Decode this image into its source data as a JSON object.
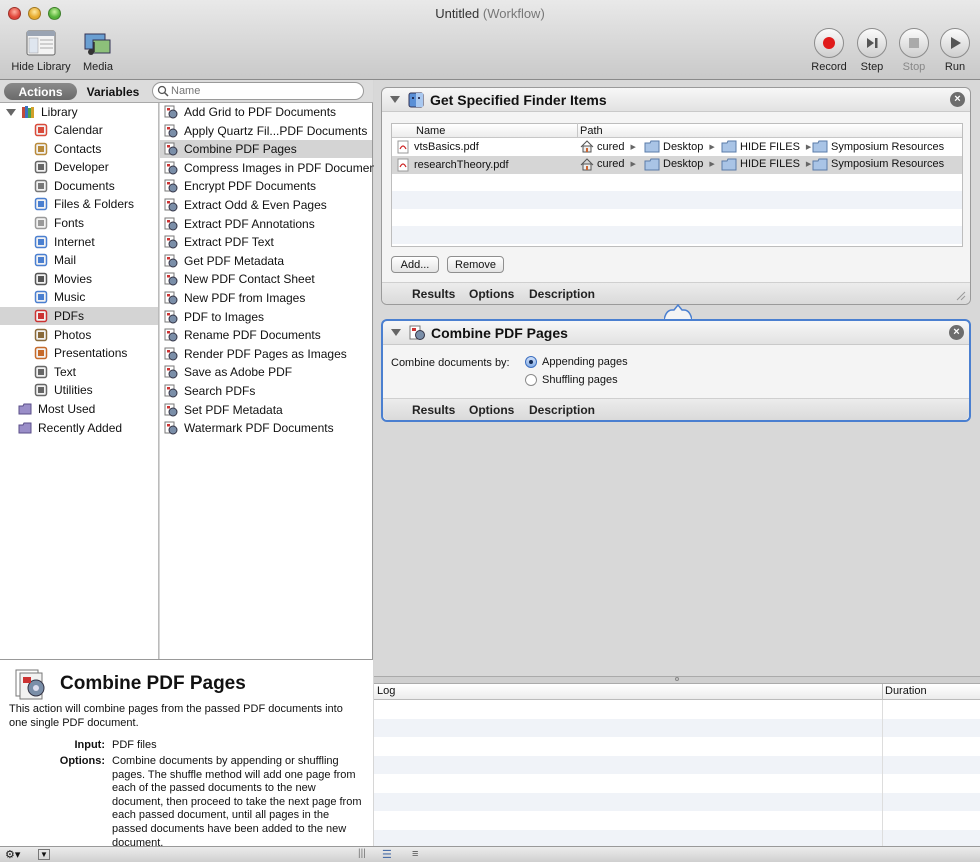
{
  "window": {
    "title": "Untitled",
    "subtitle": "(Workflow)"
  },
  "toolbar": {
    "hide_library": "Hide Library",
    "media": "Media",
    "record": "Record",
    "step": "Step",
    "stop": "Stop",
    "run": "Run"
  },
  "library": {
    "tab_actions": "Actions",
    "tab_variables": "Variables",
    "search_placeholder": "Name",
    "root": "Library",
    "categories": [
      "Calendar",
      "Contacts",
      "Developer",
      "Documents",
      "Files & Folders",
      "Fonts",
      "Internet",
      "Mail",
      "Movies",
      "Music",
      "PDFs",
      "Photos",
      "Presentations",
      "Text",
      "Utilities"
    ],
    "selected_category": "PDFs",
    "smart_groups": [
      "Most Used",
      "Recently Added"
    ],
    "actions": [
      "Add Grid to PDF Documents",
      "Apply Quartz Fil...PDF Documents",
      "Combine PDF Pages",
      "Compress Images in PDF Documents",
      "Encrypt PDF Documents",
      "Extract Odd & Even Pages",
      "Extract PDF Annotations",
      "Extract PDF Text",
      "Get PDF Metadata",
      "New PDF Contact Sheet",
      "New PDF from Images",
      "PDF to Images",
      "Rename PDF Documents",
      "Render PDF Pages as Images",
      "Save as Adobe PDF",
      "Search PDFs",
      "Set PDF Metadata",
      "Watermark PDF Documents"
    ],
    "selected_action": "Combine PDF Pages"
  },
  "description": {
    "title": "Combine PDF Pages",
    "summary": "This action will combine pages from the passed PDF documents into one single PDF document.",
    "input_label": "Input:",
    "input_value": "PDF files",
    "options_label": "Options:",
    "options_value": "Combine documents by appending or shuffling pages. The shuffle method will add one page from each of the passed documents to the new document, then proceed to take the next page from each passed document, until all pages in the passed documents have been added to the new document."
  },
  "workflow": {
    "action1": {
      "title": "Get Specified Finder Items",
      "col_name": "Name",
      "col_path": "Path",
      "files": [
        {
          "name": "vtsBasics.pdf",
          "path": [
            "cured",
            "Desktop",
            "HIDE FILES",
            "Symposium Resources"
          ]
        },
        {
          "name": "researchTheory.pdf",
          "path": [
            "cured",
            "Desktop",
            "HIDE FILES",
            "Symposium Resources"
          ]
        }
      ],
      "add_button": "Add...",
      "remove_button": "Remove",
      "footer": [
        "Results",
        "Options",
        "Description"
      ]
    },
    "action2": {
      "title": "Combine PDF Pages",
      "combine_label": "Combine documents by:",
      "option_appending": "Appending pages",
      "option_shuffling": "Shuffling pages",
      "selected_option": "Appending pages",
      "footer": [
        "Results",
        "Options",
        "Description"
      ]
    }
  },
  "log": {
    "col_log": "Log",
    "col_duration": "Duration"
  }
}
